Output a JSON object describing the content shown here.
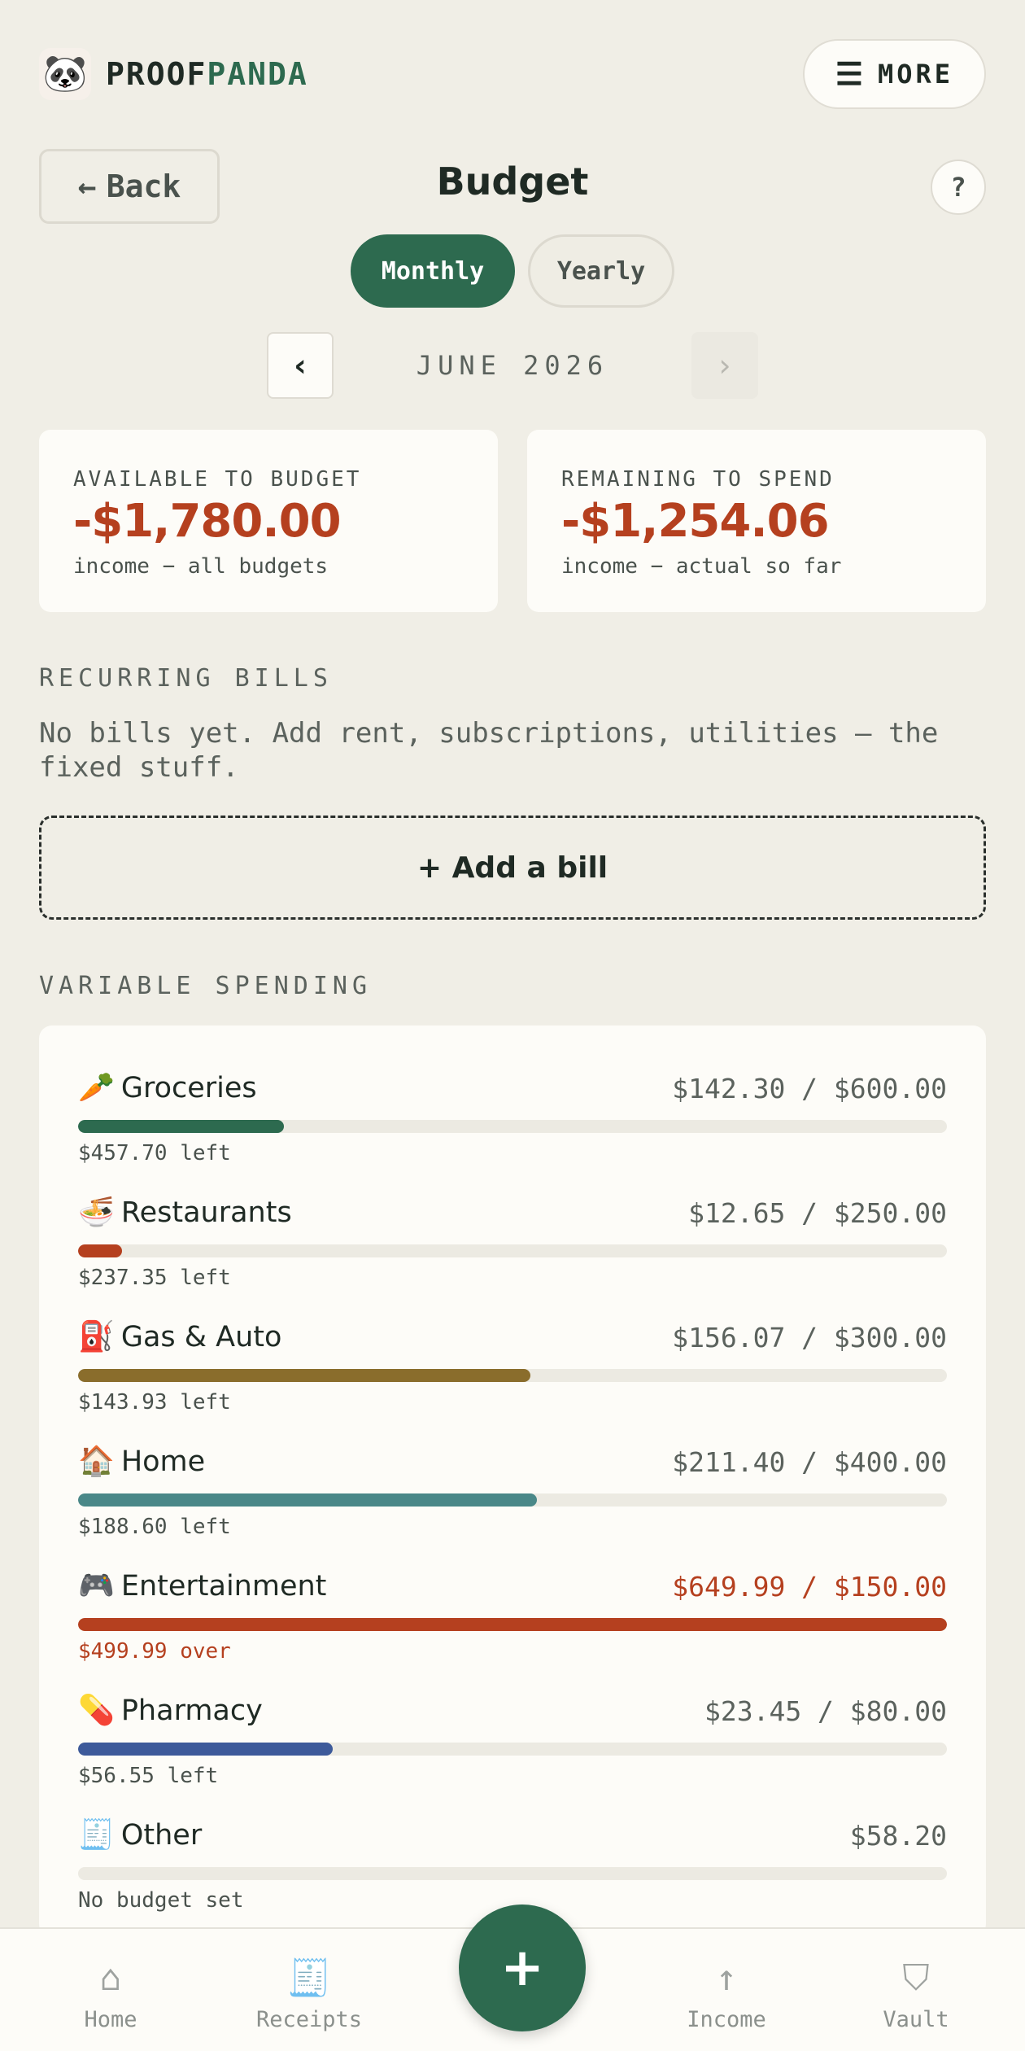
{
  "brand": {
    "prefix": "PROOF",
    "accent": "PANDA",
    "logo_icon": "panda-icon"
  },
  "header": {
    "more_label": "MORE",
    "more_icon": "☰"
  },
  "page": {
    "back_label": "Back",
    "back_icon": "←",
    "title": "Budget",
    "help_label": "?"
  },
  "period_toggle": {
    "options": [
      "Monthly",
      "Yearly"
    ],
    "selected": "Monthly"
  },
  "month_nav": {
    "prev_icon": "‹",
    "next_icon": "›",
    "label": "JUNE 2026"
  },
  "summary": {
    "available": {
      "label": "AVAILABLE TO BUDGET",
      "value": "-$1,780.00",
      "note": "income − all budgets"
    },
    "remaining": {
      "label": "REMAINING TO SPEND",
      "value": "-$1,254.06",
      "note": "income − actual so far"
    }
  },
  "recurring": {
    "label": "RECURRING BILLS",
    "empty_text": "No bills yet. Add rent, subscriptions, utilities — the fixed stuff.",
    "add_label": "+ Add a bill"
  },
  "variable": {
    "label": "VARIABLE SPENDING",
    "categories": [
      {
        "icon": "🥕",
        "icon_name": "carrot-icon",
        "name": "Groceries",
        "amount": "$142.30 / $600.00",
        "fill": 0.2372,
        "color": "#2d6a4f",
        "foot": "$457.70 left",
        "over": false
      },
      {
        "icon": "🍜",
        "icon_name": "noodle-bowl-icon",
        "name": "Restaurants",
        "amount": "$12.65 / $250.00",
        "fill": 0.0506,
        "color": "#b5401f",
        "foot": "$237.35 left",
        "over": false
      },
      {
        "icon": "⛽",
        "icon_name": "fuel-pump-icon",
        "name": "Gas & Auto",
        "amount": "$156.07 / $300.00",
        "fill": 0.5202,
        "color": "#8a6d2c",
        "foot": "$143.93 left",
        "over": false
      },
      {
        "icon": "🏠",
        "icon_name": "house-icon",
        "name": "Home",
        "amount": "$211.40 / $400.00",
        "fill": 0.5285,
        "color": "#4a8888",
        "foot": "$188.60 left",
        "over": false
      },
      {
        "icon": "🎮",
        "icon_name": "game-controller-icon",
        "name": "Entertainment",
        "amount": "$649.99 / $150.00",
        "fill": 1.0,
        "color": "#b5401f",
        "foot": "$499.99 over",
        "over": true
      },
      {
        "icon": "💊",
        "icon_name": "pill-icon",
        "name": "Pharmacy",
        "amount": "$23.45 / $80.00",
        "fill": 0.2931,
        "color": "#3d5a9a",
        "foot": "$56.55 left",
        "over": false
      },
      {
        "icon": "🧾",
        "icon_name": "receipt-icon",
        "name": "Other",
        "amount": "$58.20",
        "fill": 0,
        "color": "#cccccc",
        "foot": "No budget set",
        "over": false
      }
    ]
  },
  "bottom_nav": {
    "items": [
      {
        "label": "Home",
        "icon": "⌂",
        "icon_name": "home-icon"
      },
      {
        "label": "Receipts",
        "icon": "🧾",
        "icon_name": "receipt-icon"
      },
      {
        "label": "Income",
        "icon": "↑",
        "icon_name": "arrow-up-icon"
      },
      {
        "label": "Vault",
        "icon": "⛉",
        "icon_name": "shield-icon"
      }
    ],
    "fab_label": "+"
  },
  "colors": {
    "primary": "#2d6a4f",
    "negative": "#b5401f",
    "background": "#f0eee6",
    "card": "#fdfcf8"
  }
}
